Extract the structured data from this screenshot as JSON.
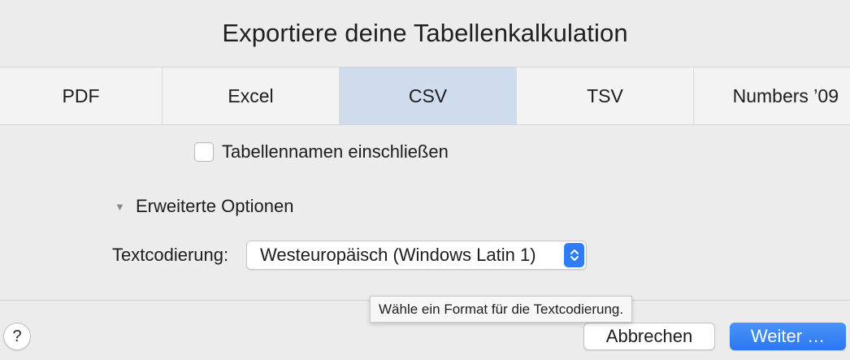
{
  "dialog": {
    "title": "Exportiere deine Tabellenkalkulation"
  },
  "tabs": [
    {
      "label": "PDF",
      "selected": false
    },
    {
      "label": "Excel",
      "selected": false
    },
    {
      "label": "CSV",
      "selected": true
    },
    {
      "label": "TSV",
      "selected": false
    },
    {
      "label": "Numbers ’09",
      "selected": false
    }
  ],
  "options": {
    "include_table_names": {
      "label": "Tabellennamen einschließen",
      "checked": false
    },
    "advanced": {
      "label": "Erweiterte Optionen",
      "expanded": true,
      "icon": "disclosure-triangle-down-icon",
      "glyph": "▼"
    },
    "encoding": {
      "label": "Textcodierung:",
      "value": "Westeuropäisch (Windows Latin 1)"
    }
  },
  "tooltip": {
    "text": "Wähle ein Format für die Textcodierung."
  },
  "footer": {
    "help_label": "?",
    "cancel_label": "Abbrechen",
    "continue_label": "Weiter …"
  },
  "colors": {
    "selected_tab": "#cfdced",
    "accent": "#2a78f3",
    "background": "#ececec"
  }
}
